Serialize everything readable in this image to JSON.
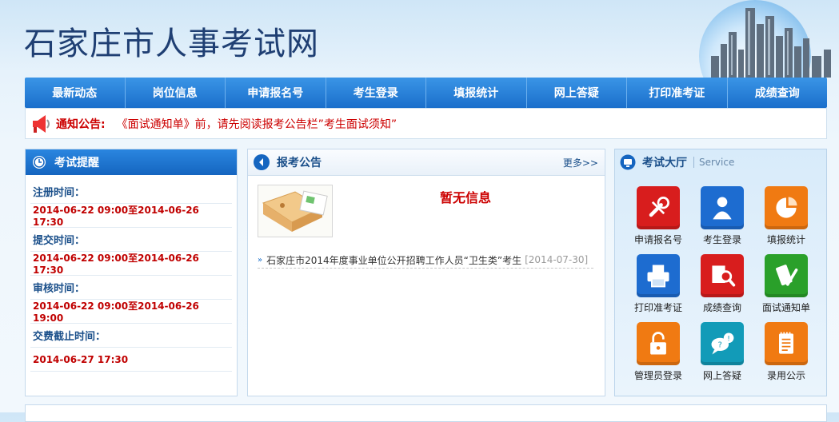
{
  "header": {
    "title": "石家庄市人事考试网"
  },
  "nav": {
    "items": [
      "最新动态",
      "岗位信息",
      "申请报名号",
      "考生登录",
      "填报统计",
      "网上答疑",
      "打印准考证",
      "成绩查询"
    ]
  },
  "notice": {
    "label": "通知公告:",
    "text": "《面试通知单》前，请先阅读报考公告栏”考生面试须知”"
  },
  "exam_reminder": {
    "title": "考试提醒",
    "rows": [
      {
        "label": "注册时间：",
        "value": "2014-06-22 09:00至2014-06-26 17:30"
      },
      {
        "label": "提交时间：",
        "value": "2014-06-22 09:00至2014-06-26 17:30"
      },
      {
        "label": "审核时间：",
        "value": "2014-06-22 09:00至2014-06-26 19:00"
      },
      {
        "label": "交费截止时间：",
        "value": "2014-06-27 17:30"
      }
    ]
  },
  "announcements": {
    "title": "报考公告",
    "more": "更多>>",
    "no_info": "暂无信息",
    "items": [
      {
        "text": "石家庄市2014年度事业单位公开招聘工作人员“卫生类”考生",
        "date": "[2014-07-30]"
      }
    ]
  },
  "exam_hall": {
    "title": "考试大厅",
    "subtitle": "Service",
    "tiles": [
      {
        "label": "申请报名号",
        "icon": "tools-icon",
        "color": "#d81d1d"
      },
      {
        "label": "考生登录",
        "icon": "user-icon",
        "color": "#1d6cd0"
      },
      {
        "label": "填报统计",
        "icon": "pie-chart-icon",
        "color": "#f07a12"
      },
      {
        "label": "打印准考证",
        "icon": "printer-icon",
        "color": "#1d6cd0"
      },
      {
        "label": "成绩查询",
        "icon": "magnifier-icon",
        "color": "#d81d1d"
      },
      {
        "label": "面试通知单",
        "icon": "pen-note-icon",
        "color": "#2aa02a"
      },
      {
        "label": "管理员登录",
        "icon": "lock-icon",
        "color": "#f07a12"
      },
      {
        "label": "网上答疑",
        "icon": "chat-icon",
        "color": "#129bb8"
      },
      {
        "label": "录用公示",
        "icon": "notepad-icon",
        "color": "#f07a12"
      }
    ]
  }
}
